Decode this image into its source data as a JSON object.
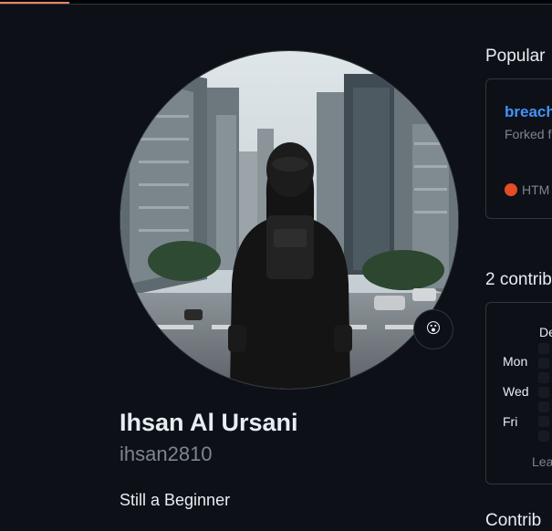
{
  "profile": {
    "name": "Ihsan Al Ursani",
    "login": "ihsan2810",
    "bio": "Still a Beginner",
    "status_icon": "face-emoji-icon",
    "status_emoji": "😮"
  },
  "popular": {
    "title": "Popular",
    "repo_name": "breach",
    "forked_text": "Forked f",
    "language": "HTM",
    "language_color": "#e34c26"
  },
  "contributions": {
    "title": "2 contrib",
    "month": "De",
    "days": [
      "Mon",
      "Wed",
      "Fri"
    ],
    "learn": "Lea"
  },
  "next_section_title": "Contrib",
  "colors": {
    "bg": "#0d1117",
    "border": "#30363d",
    "link": "#4493f8",
    "muted": "#7d8590",
    "tab_accent": "#f78166"
  }
}
